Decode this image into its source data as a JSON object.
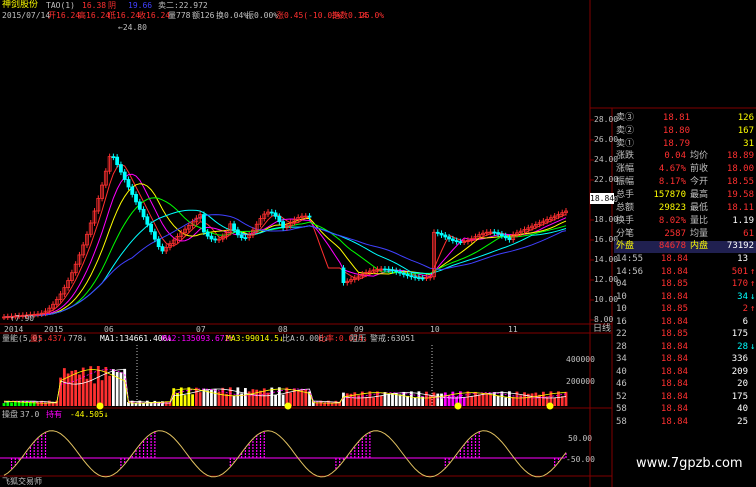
{
  "header": {
    "stock_name": "神剑股份",
    "indicator": "TAO(1)",
    "date": "2015/07/14",
    "v1": "16.38",
    "v_yin": "阴",
    "v_blue": "19.66",
    "v_jia": "卖二:22.972",
    "line2_a": "开16.24",
    "line2_b": "高16.24",
    "line2_c": "低16.24",
    "line2_d": "收16.24",
    "line2_e": "量778",
    "line2_f": "额126",
    "line2_g": "换0.04%",
    "line2_h": "振0.00%",
    "line2_i": "涨0.45(-10.03%",
    "line2_j": "指数0.14",
    "line2_k": "25.0%"
  },
  "price_axis": [
    "28.00",
    "26.00",
    "24.00",
    "22.00",
    "20.00",
    "18.00",
    "16.00",
    "14.00",
    "12.00",
    "10.00",
    "8.00"
  ],
  "current_price": "18.84",
  "annotations": {
    "high": "24.80",
    "low": "7.90"
  },
  "time_axis": [
    "2014",
    "2015",
    "06",
    "07",
    "08",
    "09",
    "10",
    "11"
  ],
  "time_axis_right": "日线",
  "volume_panel": {
    "title": "量能(5,0)",
    "items": [
      "量5.437↓",
      "778↓",
      "MA1:134661.406↓",
      "MA2:135093.672↑",
      "MA3:99014.5↓",
      "比A:0.006↓",
      "比率:0.074↓",
      "阻压",
      "警戒:63051"
    ],
    "axis": [
      "400000",
      "200000"
    ]
  },
  "osc_panel": {
    "title": "操盘",
    "items": [
      "37.0",
      "持有",
      "-44.505↓"
    ],
    "axis": [
      "50.00",
      "-50.00"
    ]
  },
  "quote": {
    "asks": [
      {
        "label": "卖③",
        "price": "18.81",
        "vol": "126"
      },
      {
        "label": "卖②",
        "price": "18.80",
        "vol": "167"
      },
      {
        "label": "卖①",
        "price": "18.79",
        "vol": "31"
      }
    ],
    "stats": [
      {
        "l1": "涨跌",
        "v1": "0.04",
        "l2": "均价",
        "v2": "18.89"
      },
      {
        "l1": "涨幅",
        "v1": "4.67%",
        "l2": "前收",
        "v2": "18.00"
      },
      {
        "l1": "振幅",
        "v1": "8.17%",
        "l2": "今开",
        "v2": "18.55"
      },
      {
        "l1": "总手",
        "v1": "157870",
        "l2": "最高",
        "v2": "19.58"
      },
      {
        "l1": "总额",
        "v1": "29823",
        "l2": "最低",
        "v2": "18.11"
      },
      {
        "l1": "换手",
        "v1": "8.02%",
        "l2": "量比",
        "v2": "1.19"
      },
      {
        "l1": "分笔",
        "v1": "2587",
        "l2": "均量",
        "v2": "61"
      }
    ],
    "outer": {
      "l1": "外盘",
      "v1": "84678",
      "l2": "内盘",
      "v2": "73192"
    }
  },
  "ticks": [
    {
      "t": "14:55",
      "p": "18.84",
      "v": "13",
      "a": ""
    },
    {
      "t": "14:56",
      "p": "18.84",
      "v": "501",
      "a": "↑"
    },
    {
      "t": "04",
      "p": "18.85",
      "v": "170",
      "a": "↑"
    },
    {
      "t": "10",
      "p": "18.84",
      "v": "34",
      "a": "↓"
    },
    {
      "t": "10",
      "p": "18.85",
      "v": "2",
      "a": "↑"
    },
    {
      "t": "16",
      "p": "18.84",
      "v": "6",
      "a": ""
    },
    {
      "t": "22",
      "p": "18.85",
      "v": "175",
      "a": ""
    },
    {
      "t": "28",
      "p": "18.84",
      "v": "28",
      "a": "↓"
    },
    {
      "t": "34",
      "p": "18.84",
      "v": "336",
      "a": ""
    },
    {
      "t": "40",
      "p": "18.84",
      "v": "209",
      "a": ""
    },
    {
      "t": "46",
      "p": "18.84",
      "v": "20",
      "a": ""
    },
    {
      "t": "52",
      "p": "18.84",
      "v": "175",
      "a": ""
    },
    {
      "t": "58",
      "p": "18.84",
      "v": "40",
      "a": ""
    },
    {
      "t": "58",
      "p": "18.84",
      "v": "25",
      "a": ""
    }
  ],
  "watermark": "www.7gpzb.com",
  "footer_app": "飞狐交易师",
  "colors": {
    "up": "#ff3030",
    "down": "#00ffff",
    "yellow": "#ffff00",
    "magenta": "#ff00ff",
    "green": "#00ff00"
  }
}
